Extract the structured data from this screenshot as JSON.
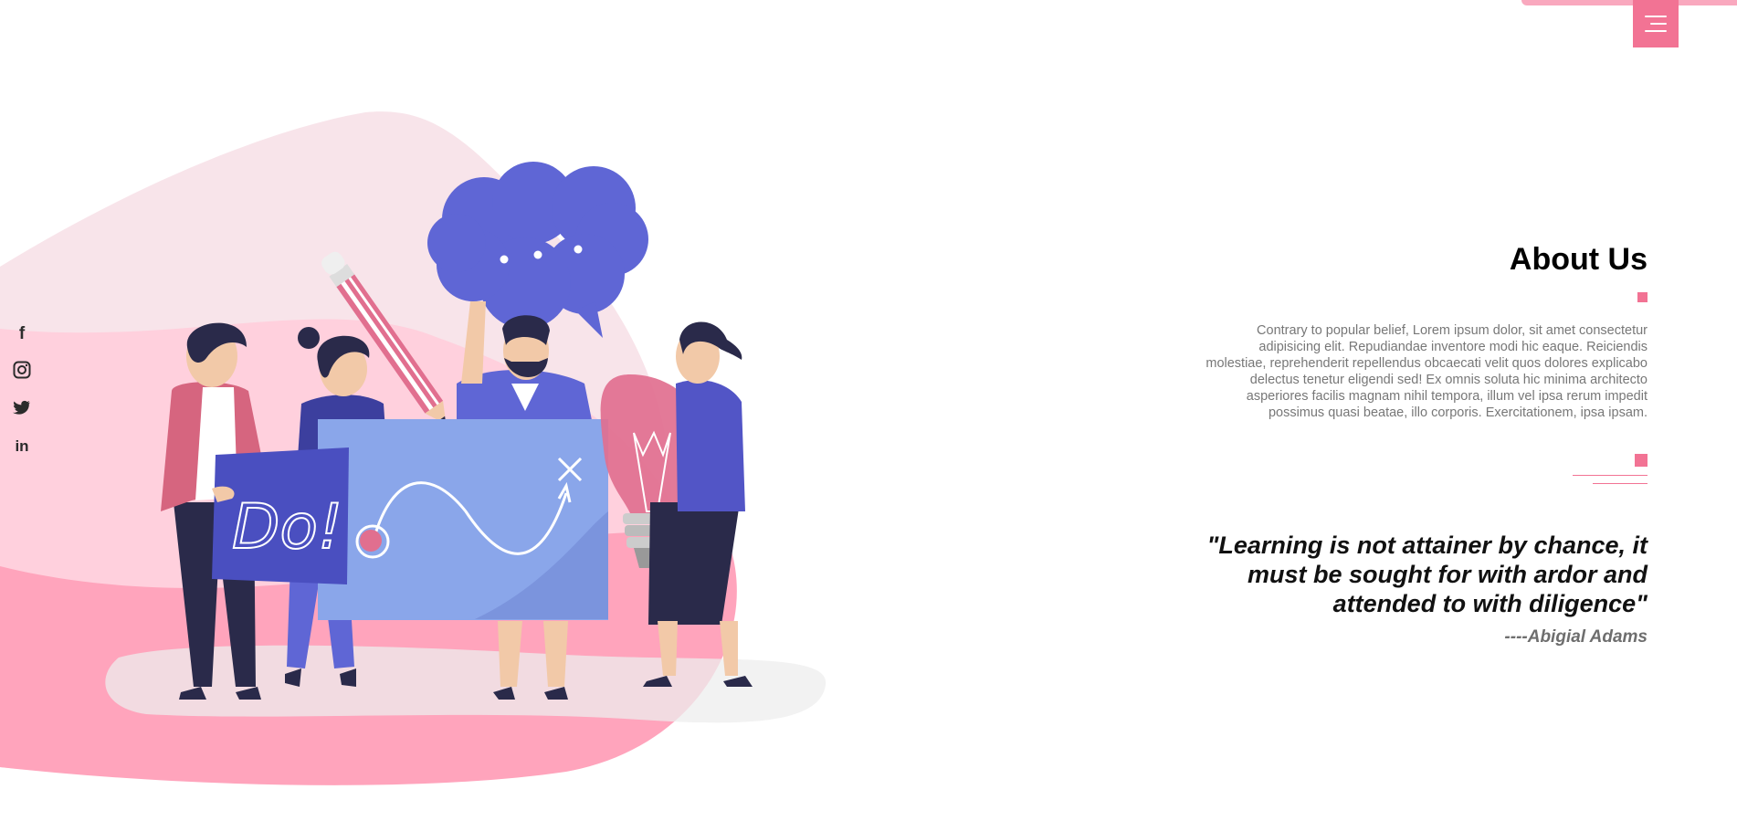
{
  "nav": {
    "menu_icon": "hamburger-menu-icon"
  },
  "social": [
    {
      "icon": "facebook-icon",
      "glyph": "f"
    },
    {
      "icon": "instagram-icon"
    },
    {
      "icon": "twitter-icon"
    },
    {
      "icon": "linkedin-icon",
      "glyph": "in"
    }
  ],
  "illustration": {
    "sign_text": "Do!",
    "description": "team-brainstorming-illustration"
  },
  "about": {
    "title": "About Us",
    "text": "Contrary to popular belief, Lorem ipsum dolor, sit amet consectetur adipisicing elit. Repudiandae inventore modi hic eaque. Reiciendis molestiae, reprehenderit repellendus obcaecati velit quos dolores explicabo delectus tenetur eligendi sed! Ex omnis soluta hic minima architecto asperiores facilis magnam nihil tempora, illum vel ipsa rerum impedit possimus quasi beatae, illo corporis. Exercitationem, ipsa ipsam.",
    "quote": "\"Learning is not attainer by chance, it must be sought for with ardor and attended to with diligence\"",
    "author": "----Abigial Adams"
  },
  "colors": {
    "accent": "#f27394",
    "blob_light": "#f8e4ea",
    "blob_mid": "#ffd0dd",
    "blob_dark": "#ffa4bc",
    "purple": "#5f66d5",
    "board": "#8aa6ea"
  }
}
